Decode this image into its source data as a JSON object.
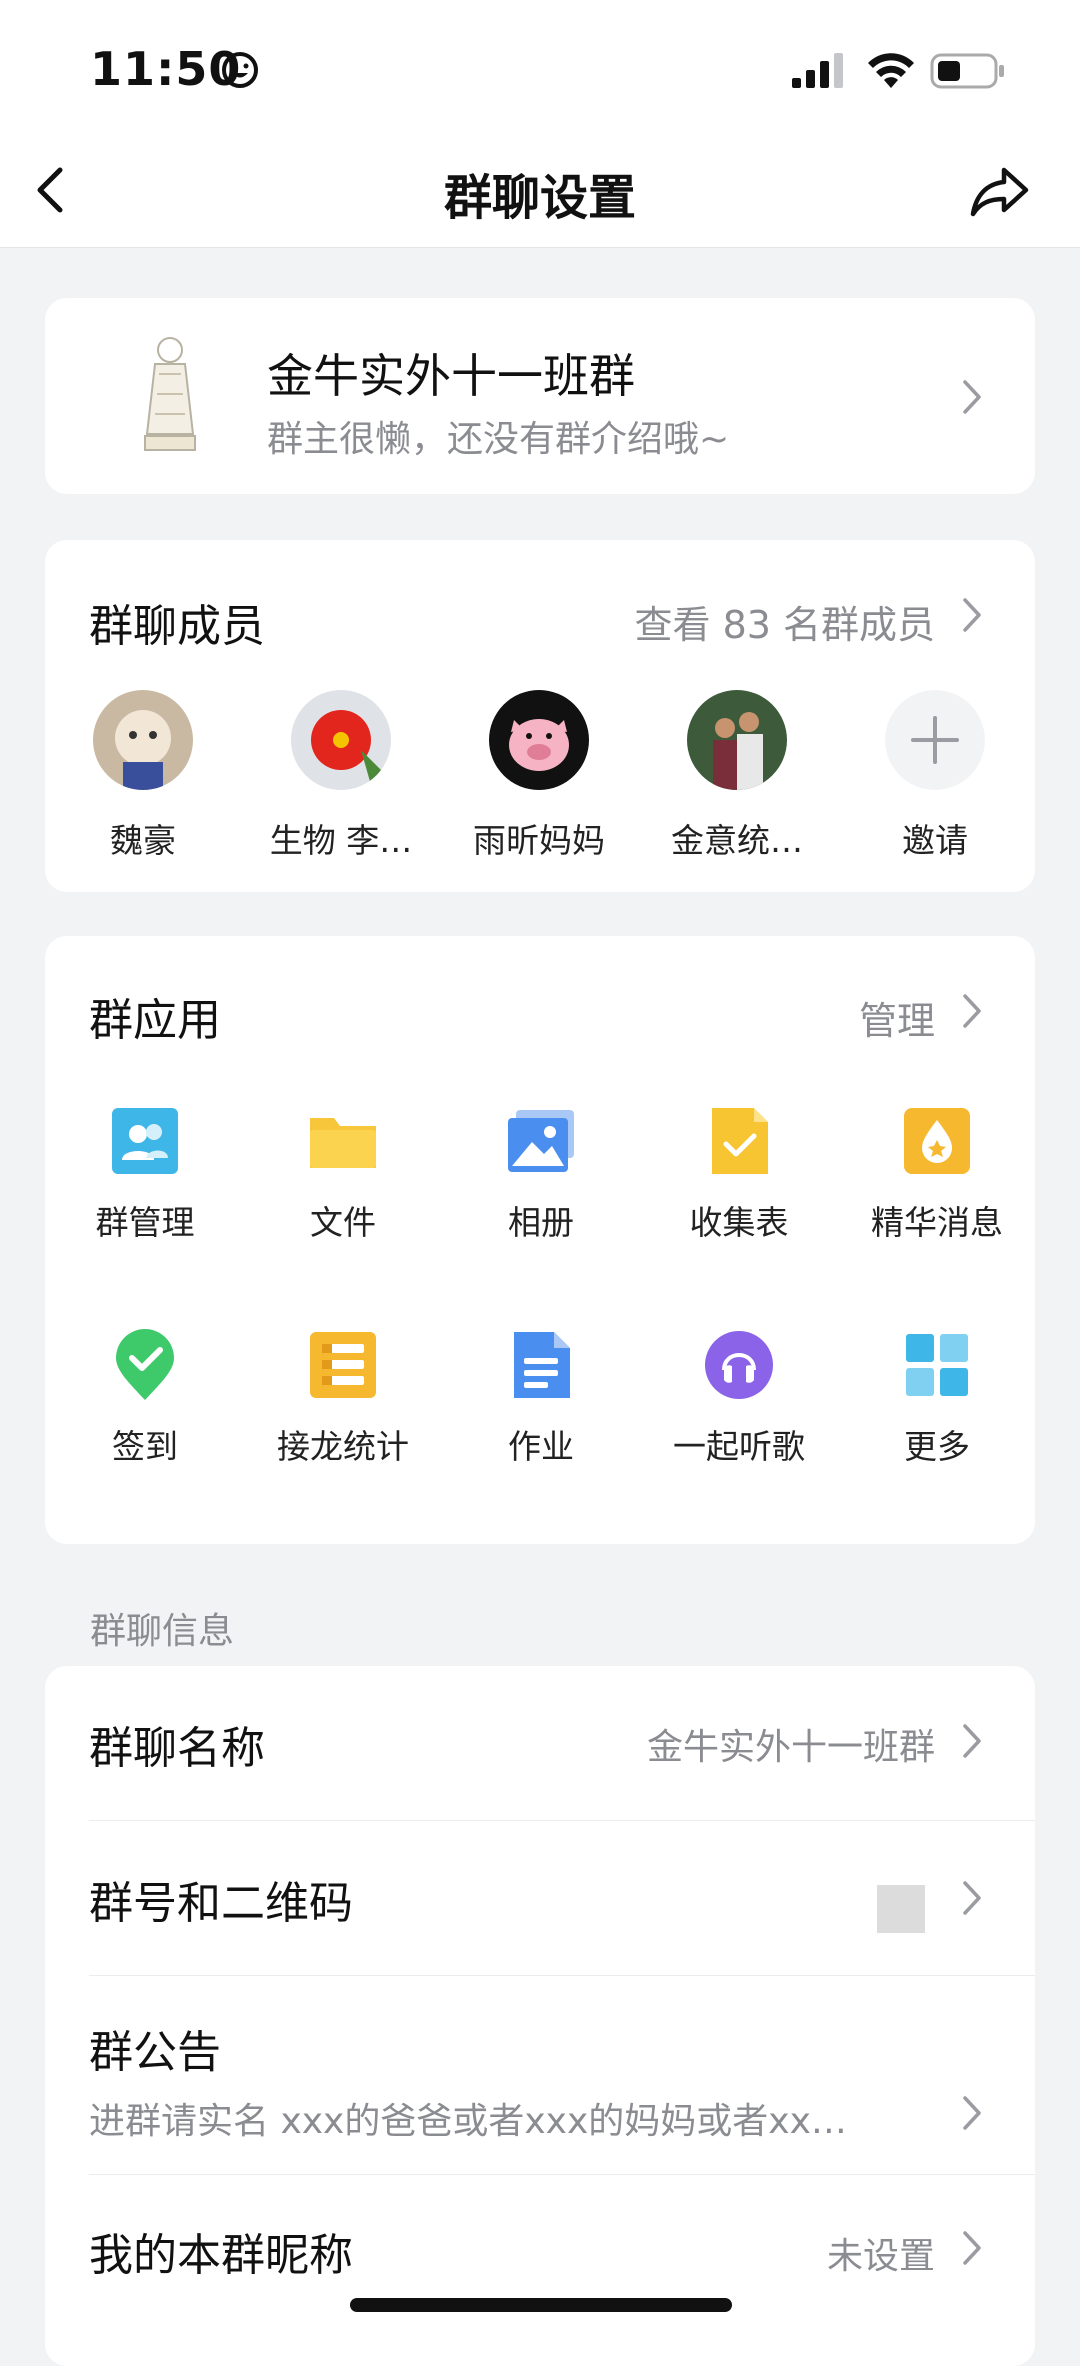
{
  "status": {
    "time": "11:50"
  },
  "nav": {
    "title": "群聊设置"
  },
  "group": {
    "name": "金牛实外十一班群",
    "intro": "群主很懒，还没有群介绍哦~"
  },
  "members": {
    "title": "群聊成员",
    "view_all": "查看 83 名群成员",
    "list": [
      {
        "name": "魏豪"
      },
      {
        "name": "生物 李…"
      },
      {
        "name": "雨昕妈妈"
      },
      {
        "name": "金意统…"
      },
      {
        "name": "邀请"
      }
    ]
  },
  "apps": {
    "title": "群应用",
    "manage": "管理",
    "items": [
      {
        "label": "群管理",
        "icon": "group-manage-icon",
        "color": "#3fb6e8"
      },
      {
        "label": "文件",
        "icon": "folder-icon",
        "color": "#f8c63b"
      },
      {
        "label": "相册",
        "icon": "album-icon",
        "color": "#4a8ff0"
      },
      {
        "label": "收集表",
        "icon": "form-icon",
        "color": "#f6c531"
      },
      {
        "label": "精华消息",
        "icon": "essence-icon",
        "color": "#f5b82e"
      },
      {
        "label": "签到",
        "icon": "checkin-icon",
        "color": "#3ec96b"
      },
      {
        "label": "接龙统计",
        "icon": "relay-icon",
        "color": "#f5b82e"
      },
      {
        "label": "作业",
        "icon": "homework-icon",
        "color": "#4a8ff0"
      },
      {
        "label": "一起听歌",
        "icon": "music-icon",
        "color": "#8a63e8"
      },
      {
        "label": "更多",
        "icon": "more-grid-icon",
        "color": "#3fb6e8"
      }
    ]
  },
  "info": {
    "header": "群聊信息",
    "group_name_label": "群聊名称",
    "group_name_value": "金牛实外十一班群",
    "qr_label": "群号和二维码",
    "notice_label": "群公告",
    "notice_value": "进群请实名  xxx的爸爸或者xxx的妈妈或者xx…",
    "nickname_label": "我的本群昵称",
    "nickname_value": "未设置"
  }
}
